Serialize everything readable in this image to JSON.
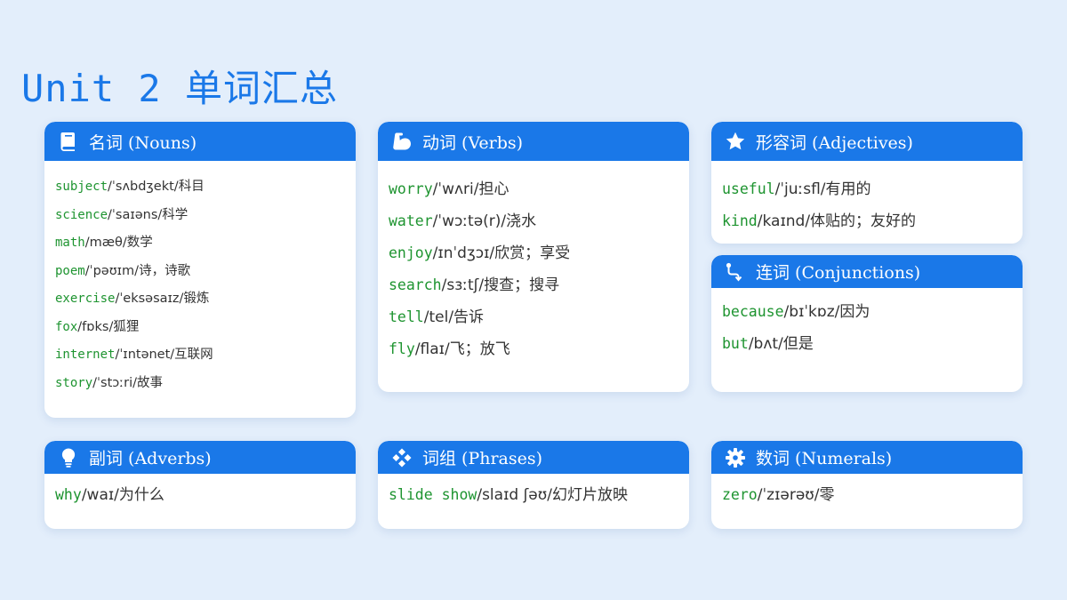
{
  "title": "Unit 2 单词汇总",
  "colors": {
    "accent": "#1a78e8",
    "word": "#1e9430",
    "text": "#333333",
    "background": "#e3eefb"
  },
  "cards": {
    "nouns": {
      "icon": "book-icon",
      "title": "名词 (Nouns)",
      "entries": [
        {
          "word": "subject",
          "rest": "/ˈsʌbdʒekt/科目"
        },
        {
          "word": "science",
          "rest": "/ˈsaɪəns/科学"
        },
        {
          "word": "math",
          "rest": "/mæθ/数学"
        },
        {
          "word": "poem",
          "rest": "/ˈpəʊɪm/诗，诗歌"
        },
        {
          "word": "exercise",
          "rest": "/ˈeksəsaɪz/锻炼"
        },
        {
          "word": "fox",
          "rest": "/fɒks/狐狸"
        },
        {
          "word": "internet",
          "rest": "/ˈɪntənet/互联网"
        },
        {
          "word": "story",
          "rest": "/ˈstɔːri/故事"
        }
      ]
    },
    "verbs": {
      "icon": "flexed-arm-icon",
      "title": "动词 (Verbs)",
      "entries": [
        {
          "word": "worry",
          "rest": "/ˈwʌri/担心"
        },
        {
          "word": "water",
          "rest": "/ˈwɔːtə(r)/浇水"
        },
        {
          "word": "enjoy",
          "rest": "/ɪnˈdʒɔɪ/欣赏；享受"
        },
        {
          "word": "search",
          "rest": "/sɜːtʃ/搜查；搜寻"
        },
        {
          "word": "tell",
          "rest": "/tel/告诉"
        },
        {
          "word": "fly",
          "rest": "/flaɪ/飞；放飞"
        }
      ]
    },
    "adjectives": {
      "icon": "star-icon",
      "title": "形容词 (Adjectives)",
      "entries": [
        {
          "word": "useful",
          "rest": "/ˈjuːsfl/有用的"
        },
        {
          "word": "kind",
          "rest": "/kaɪnd/体贴的；友好的"
        }
      ]
    },
    "conjunctions": {
      "icon": "route-icon",
      "title": "连词 (Conjunctions)",
      "entries": [
        {
          "word": "because",
          "rest": "/bɪˈkɒz/因为"
        },
        {
          "word": "but",
          "rest": "/bʌt/但是"
        }
      ]
    },
    "adverbs": {
      "icon": "lightbulb-icon",
      "title": "副词 (Adverbs)",
      "entries": [
        {
          "word": "why",
          "rest": "/waɪ/为什么"
        }
      ]
    },
    "phrases": {
      "icon": "diamonds-icon",
      "title": "词组 (Phrases)",
      "entries": [
        {
          "word": "slide show",
          "rest": "/slaɪd ʃəʊ/幻灯片放映"
        }
      ]
    },
    "numerals": {
      "icon": "gear-icon",
      "title": "数词 (Numerals)",
      "entries": [
        {
          "word": "zero",
          "rest": "/ˈzɪərəʊ/零"
        }
      ]
    }
  }
}
